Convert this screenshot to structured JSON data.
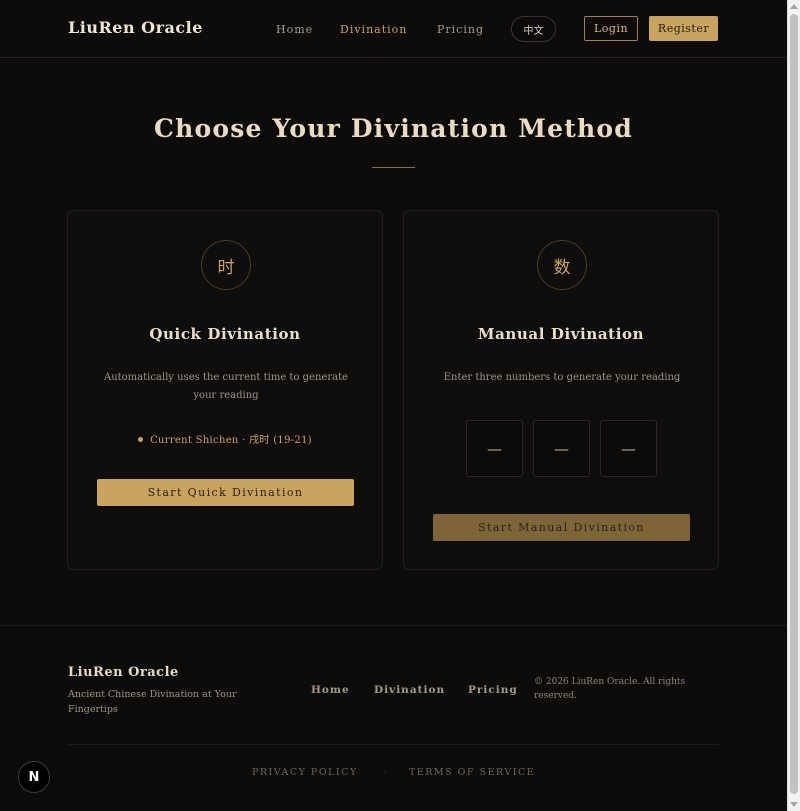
{
  "header": {
    "brand": "LiuRen Oracle",
    "nav": [
      {
        "label": "Home",
        "active": false
      },
      {
        "label": "Divination",
        "active": true
      },
      {
        "label": "Pricing",
        "active": false
      }
    ],
    "language_toggle": "中文",
    "login_label": "Login",
    "register_label": "Register"
  },
  "main": {
    "title": "Choose Your Divination Method",
    "quick": {
      "icon_char": "时",
      "title": "Quick Divination",
      "description": "Automatically uses the current time to generate your reading",
      "shichen_label": "Current Shichen ·",
      "shichen_value": "戌时",
      "shichen_hours": "(19-21)",
      "button_label": "Start Quick Divination"
    },
    "manual": {
      "icon_char": "数",
      "title": "Manual Divination",
      "description": "Enter three numbers to generate your reading",
      "inputs": [
        "—",
        "—",
        "—"
      ],
      "button_label": "Start Manual Divination"
    }
  },
  "footer": {
    "brand": "LiuRen Oracle",
    "tagline": "Ancient Chinese Divination at Your Fingertips",
    "links": [
      "Home",
      "Divination",
      "Pricing"
    ],
    "copyright": "© 2026 LiuRen Oracle. All rights reserved.",
    "legal": {
      "privacy": "PRIVACY POLICY",
      "separator": "·",
      "terms": "TERMS OF SERVICE"
    }
  },
  "dev_badge": "N",
  "colors": {
    "background": "#0d0c0b",
    "accent_gold": "#c9a45e",
    "accent_gold_dim": "#7d6537",
    "text_primary": "#eadfca",
    "text_muted": "#9e9484"
  }
}
